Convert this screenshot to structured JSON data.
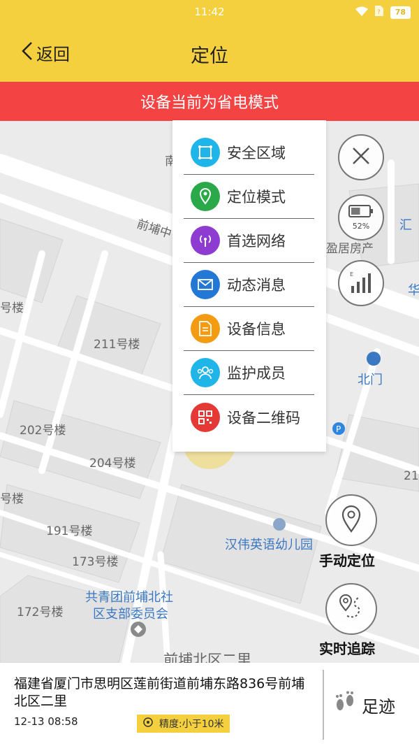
{
  "status_bar": {
    "time": "11:42",
    "battery": "78"
  },
  "header": {
    "back_label": "返回",
    "title": "定位"
  },
  "banner": {
    "text": "设备当前为省电模式"
  },
  "menu": {
    "items": [
      {
        "label": "安全区域",
        "icon": "safe-area-icon",
        "color": "#1fb5e8"
      },
      {
        "label": "定位模式",
        "icon": "location-pin-icon",
        "color": "#2aa84a"
      },
      {
        "label": "首选网络",
        "icon": "antenna-icon",
        "color": "#8e3bd1"
      },
      {
        "label": "动态消息",
        "icon": "envelope-icon",
        "color": "#2378d6"
      },
      {
        "label": "设备信息",
        "icon": "document-icon",
        "color": "#f39c12"
      },
      {
        "label": "监护成员",
        "icon": "members-icon",
        "color": "#1fb5e8"
      },
      {
        "label": "设备二维码",
        "icon": "qrcode-icon",
        "color": "#e53935"
      }
    ]
  },
  "device": {
    "battery_percent": "52%",
    "battery_level": 0.52
  },
  "map": {
    "labels": [
      "211号楼",
      "202号楼",
      "204号楼",
      "191号楼",
      "173号楼",
      "172号楼",
      "号楼",
      "号楼",
      "前埔中",
      "盈居房产",
      "北门",
      "汉伟英语幼儿园",
      "共青团前埔北社",
      "区支部委员会",
      "前埔北区二里",
      "汇",
      "华",
      "21",
      "南"
    ]
  },
  "controls": {
    "manual_locate": "手动定位",
    "realtime_track": "实时追踪"
  },
  "location": {
    "address": "福建省厦门市思明区莲前街道前埔东路836号前埔北区二里",
    "time": "12-13 08:58",
    "accuracy": "精度:小于10米"
  },
  "footprint": {
    "label": "足迹"
  }
}
